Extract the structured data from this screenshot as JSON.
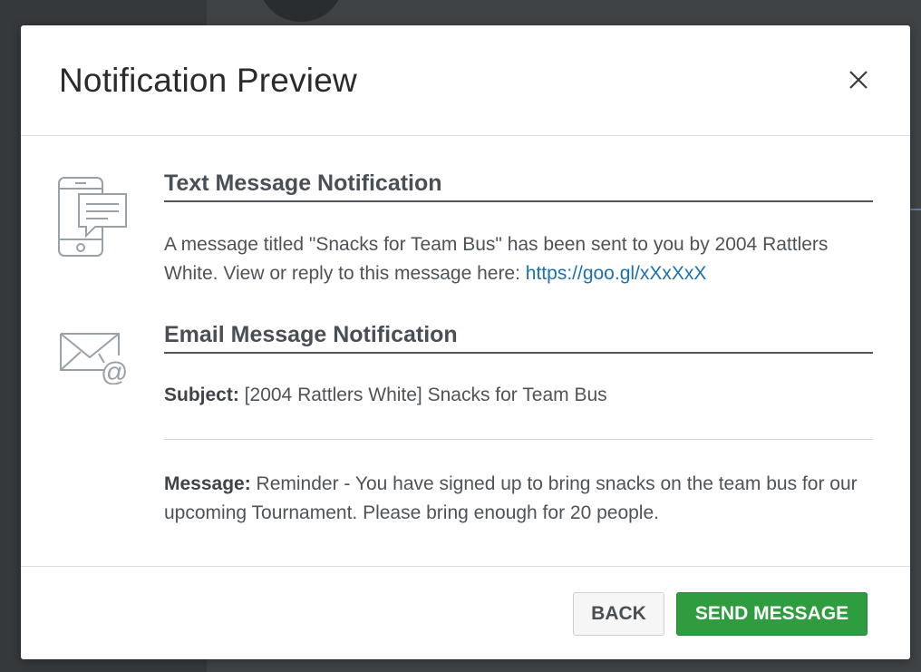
{
  "modal": {
    "title": "Notification Preview",
    "close_icon": "close-icon"
  },
  "text_section": {
    "icon": "mobile-chat-icon",
    "title": "Text Message Notification",
    "message_prefix": "A message titled \"Snacks for Team Bus\" has been sent to you by 2004 Rattlers White. View or reply to this message here: ",
    "link": "https://goo.gl/xXxXxX"
  },
  "email_section": {
    "icon": "envelope-at-icon",
    "title": "Email Message Notification",
    "subject_label": "Subject:",
    "subject_value": " [2004 Rattlers White] Snacks for Team Bus",
    "message_label": "Message:",
    "message_value": " Reminder - You have signed up to bring snacks on the team bus for our upcoming Tournament. Please bring enough for 20 people."
  },
  "footer": {
    "back_label": "BACK",
    "send_label": "SEND MESSAGE"
  },
  "colors": {
    "send_button": "#2f9d3f",
    "link": "#1e6fae",
    "backdrop": "#3f4346"
  }
}
